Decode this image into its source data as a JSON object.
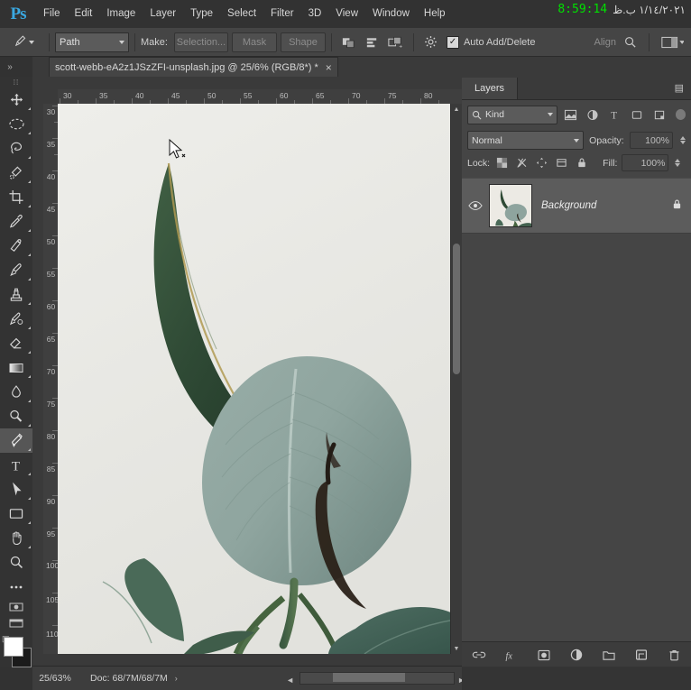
{
  "app": {
    "logo": "Ps",
    "menus": [
      "File",
      "Edit",
      "Image",
      "Layer",
      "Type",
      "Select",
      "Filter",
      "3D",
      "View",
      "Window",
      "Help"
    ],
    "clock_time": "8:59:14",
    "clock_date": "١/١٤/٢٠٢١ ب.ظ"
  },
  "options_bar": {
    "tool_preset_icon": "pen-tool-icon",
    "mode_value": "Path",
    "make_label": "Make:",
    "selection_label": "Selection...",
    "mask_label": "Mask",
    "shape_label": "Shape",
    "path_ops_icon": "path-operations-icon",
    "path_align_icon": "path-alignment-icon",
    "path_arrange_icon": "path-arrangement-icon",
    "gear_icon": "gear-icon",
    "auto_add_delete_label": "Auto Add/Delete",
    "auto_add_delete_checked": true,
    "align_label": "Align",
    "align_edges_icon": "align-edges-icon",
    "workspace_icon": "workspace-switcher-icon"
  },
  "document": {
    "tab_title": "scott-webb-eA2z1JSzZFI-unsplash.jpg @ 25/6% (RGB/8*) *",
    "close_label": "×"
  },
  "tools": [
    {
      "name": "move-tool",
      "label": "Move Tool",
      "icon": "move-icon",
      "active": false,
      "has_more": true
    },
    {
      "name": "elliptical-marquee-tool",
      "label": "Elliptical Marquee Tool",
      "icon": "ellipse-marquee-icon",
      "active": false,
      "has_more": true
    },
    {
      "name": "lasso-tool",
      "label": "Lasso Tool",
      "icon": "lasso-icon",
      "active": false,
      "has_more": true
    },
    {
      "name": "quick-selection-tool",
      "label": "Quick Selection Tool",
      "icon": "quick-select-icon",
      "active": false,
      "has_more": true
    },
    {
      "name": "crop-tool",
      "label": "Crop Tool",
      "icon": "crop-icon",
      "active": false,
      "has_more": true
    },
    {
      "name": "eyedropper-tool",
      "label": "Eyedropper Tool",
      "icon": "eyedropper-icon",
      "active": false,
      "has_more": true
    },
    {
      "name": "spot-healing-brush-tool",
      "label": "Spot Healing Brush Tool",
      "icon": "healing-brush-icon",
      "active": false,
      "has_more": true
    },
    {
      "name": "brush-tool",
      "label": "Brush Tool",
      "icon": "brush-icon",
      "active": false,
      "has_more": true
    },
    {
      "name": "clone-stamp-tool",
      "label": "Clone Stamp Tool",
      "icon": "clone-stamp-icon",
      "active": false,
      "has_more": true
    },
    {
      "name": "history-brush-tool",
      "label": "History Brush Tool",
      "icon": "history-brush-icon",
      "active": false,
      "has_more": true
    },
    {
      "name": "eraser-tool",
      "label": "Eraser Tool",
      "icon": "eraser-icon",
      "active": false,
      "has_more": true
    },
    {
      "name": "gradient-tool",
      "label": "Gradient Tool",
      "icon": "gradient-icon",
      "active": false,
      "has_more": true
    },
    {
      "name": "blur-tool",
      "label": "Blur Tool",
      "icon": "blur-drop-icon",
      "active": false,
      "has_more": true
    },
    {
      "name": "dodge-tool",
      "label": "Dodge Tool",
      "icon": "dodge-icon",
      "active": false,
      "has_more": true
    },
    {
      "name": "pen-tool",
      "label": "Pen Tool",
      "icon": "pen-icon",
      "active": true,
      "has_more": true
    },
    {
      "name": "horizontal-type-tool",
      "label": "Horizontal Type Tool",
      "icon": "type-T-icon",
      "active": false,
      "has_more": true
    },
    {
      "name": "path-selection-tool",
      "label": "Path Selection Tool",
      "icon": "path-arrow-icon",
      "active": false,
      "has_more": true
    },
    {
      "name": "rectangle-tool",
      "label": "Rectangle Tool",
      "icon": "rectangle-icon",
      "active": false,
      "has_more": true
    },
    {
      "name": "hand-tool",
      "label": "Hand Tool",
      "icon": "hand-icon",
      "active": false,
      "has_more": true
    },
    {
      "name": "zoom-tool",
      "label": "Zoom Tool",
      "icon": "magnifier-icon",
      "active": false,
      "has_more": false
    },
    {
      "name": "edit-toolbar",
      "label": "Edit Toolbar",
      "icon": "ellipsis-icon",
      "active": false,
      "has_more": false
    }
  ],
  "colors": {
    "foreground": "#ffffff",
    "background": "#1b1b1b",
    "accent_blue": "#3aa8e0",
    "clock_green": "#00e000"
  },
  "rulers": {
    "horizontal_labels": [
      "30",
      "35",
      "40",
      "45",
      "50",
      "55",
      "60",
      "65",
      "70",
      "75",
      "80"
    ],
    "vertical_labels": [
      "30",
      "35",
      "40",
      "45",
      "50",
      "55",
      "60",
      "65",
      "70",
      "75",
      "80",
      "85",
      "90",
      "95",
      "100",
      "105",
      "110"
    ]
  },
  "status_bar": {
    "zoom": "25/63%",
    "doc_info": "Doc: 68/7M/68/7M",
    "arrow": "›"
  },
  "layers_panel": {
    "tab_label": "Layers",
    "menu_icon": "panel-menu-icon",
    "filter": {
      "kind_label": "Kind",
      "search_icon": "search-icon",
      "filter_icons": [
        "pixel-filter-icon",
        "adjustment-filter-icon",
        "type-filter-icon",
        "shape-filter-icon",
        "smart-object-filter-icon"
      ],
      "toggle_on": true
    },
    "blend_mode": "Normal",
    "opacity_label": "Opacity:",
    "opacity_value": "100%",
    "lock_label": "Lock:",
    "lock_icons": [
      "lock-transparent-icon",
      "lock-image-icon",
      "lock-position-icon",
      "lock-artboard-icon",
      "lock-all-icon"
    ],
    "fill_label": "Fill:",
    "fill_value": "100%",
    "layers": [
      {
        "name": "Background",
        "visible": true,
        "locked": true,
        "eye_icon": "eye-icon",
        "lock_icon": "lock-icon",
        "thumbnail": "plant-photo-thumbnail"
      }
    ],
    "footer_icons": [
      "link-layers-icon",
      "layer-style-fx-icon",
      "layer-mask-icon",
      "adjustment-layer-icon",
      "new-group-icon",
      "new-layer-icon",
      "delete-layer-icon"
    ]
  }
}
